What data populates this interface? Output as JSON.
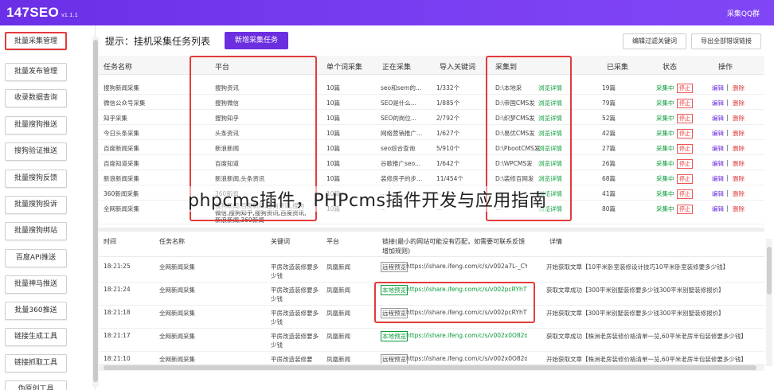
{
  "app": {
    "name": "147SEO",
    "version": "v1.1.1",
    "top_right": "采集QQ群"
  },
  "sidebar": {
    "items": [
      {
        "label": "批量采集管理",
        "active": true
      },
      {
        "label": "批量发布管理"
      },
      {
        "label": "收录数据查询"
      },
      {
        "label": "批量搜狗推送"
      },
      {
        "label": "搜狗验证推送"
      },
      {
        "label": "批量搜狗反馈"
      },
      {
        "label": "批量搜狗投诉"
      },
      {
        "label": "批量搜狗绑站"
      },
      {
        "label": "百度API推送"
      },
      {
        "label": "批量神马推送"
      },
      {
        "label": "批量360推送"
      },
      {
        "label": "链接生成工具"
      },
      {
        "label": "链接抓取工具"
      },
      {
        "label": "伪原创工具"
      }
    ]
  },
  "header": {
    "hint": "提示：挂机采集任务列表",
    "new_task": "新增采集任务",
    "filter_keywords": "编辑过滤关键词",
    "export_errors": "导出全部错误链接"
  },
  "table": {
    "columns": [
      "任务名称",
      "平台",
      "单个词采集",
      "正在采集",
      "导入关键词",
      "采集到",
      "已采集",
      "状态",
      "操作"
    ],
    "rows": [
      {
        "name": "搜狗新闻采集",
        "platform": "搜狗资讯",
        "single": "10篇",
        "current": "seo和sem的...",
        "imported": "1/332个",
        "dest": "D:\\本地采",
        "preview": "浏览详情",
        "collected": "19篇",
        "status": "采集中",
        "stop": "停止",
        "edit": "编辑",
        "delete": "删除"
      },
      {
        "name": "微信公众号采集",
        "platform": "搜狗微信",
        "single": "10篇",
        "current": "SEO是什么...",
        "imported": "1/885个",
        "dest": "D:\\帝国CMS发",
        "preview": "浏览详情",
        "collected": "79篇",
        "status": "采集中",
        "stop": "停止",
        "edit": "编辑",
        "delete": "删除"
      },
      {
        "name": "知乎采集",
        "platform": "搜狗知乎",
        "single": "10篇",
        "current": "SEO的岗位...",
        "imported": "2/792个",
        "dest": "D:\\织梦CMS发",
        "preview": "浏览详情",
        "collected": "52篇",
        "status": "采集中",
        "stop": "停止",
        "edit": "编辑",
        "delete": "删除"
      },
      {
        "name": "今日头条采集",
        "platform": "头条资讯",
        "single": "10篇",
        "current": "网络营销推广...",
        "imported": "1/627个",
        "dest": "D:\\易优CMS发",
        "preview": "浏览详情",
        "collected": "42篇",
        "status": "采集中",
        "stop": "停止",
        "edit": "编辑",
        "delete": "删除"
      },
      {
        "name": "百度新闻采集",
        "platform": "新浪新闻",
        "single": "10篇",
        "current": "seo综合查询",
        "imported": "5/910个",
        "dest": "D:\\PbootCMS发",
        "preview": "浏览详情",
        "collected": "27篇",
        "status": "采集中",
        "stop": "停止",
        "edit": "编辑",
        "delete": "删除"
      },
      {
        "name": "百度知道采集",
        "platform": "百度知道",
        "single": "10篇",
        "current": "谷歌推广seo...",
        "imported": "1/642个",
        "dest": "D:\\WPCMS发",
        "preview": "浏览详情",
        "collected": "26篇",
        "status": "采集中",
        "stop": "停止",
        "edit": "编辑",
        "delete": "删除"
      },
      {
        "name": "新浪新闻采集",
        "platform": "新浪新闻,头条资讯",
        "single": "10篇",
        "current": "装修房子的步...",
        "imported": "11/454个",
        "dest": "D:\\装修百网发",
        "preview": "浏览详情",
        "collected": "68篇",
        "status": "采集中",
        "stop": "停止",
        "edit": "编辑",
        "delete": "删除"
      },
      {
        "name": "360新闻采集",
        "platform": "360新闻",
        "single": "10篇",
        "current": "...",
        "imported": "...",
        "dest": "...",
        "preview": "浏览详情",
        "collected": "41篇",
        "status": "采集中",
        "stop": "停止",
        "edit": "编辑",
        "delete": "删除"
      },
      {
        "name": "全网新闻采集",
        "platform": "搜狗新闻,百度新闻,搜狗资讯,搜狗微信,搜狗知乎,搜狗资讯,百度资讯,新浪新闻,360新闻",
        "single": "10篇",
        "current": "...",
        "imported": "...",
        "dest": "...",
        "preview": "浏览详情",
        "collected": "80篇",
        "status": "采集中",
        "stop": "停止",
        "edit": "编辑",
        "delete": "删除"
      }
    ]
  },
  "log": {
    "columns": [
      "时间",
      "任务名称",
      "关键词",
      "平台",
      "链接(最小的网站可能没有匹配，如需要可联系反馈增加规则)",
      "详情"
    ],
    "rows": [
      {
        "time": "18:21:25",
        "task": "全网新闻采集",
        "keyword": "平房改造装修要多少钱",
        "platform": "凤凰新闻",
        "tag": "远程预览",
        "local": false,
        "url": "https://ishare.ifeng.com/c/s/v002a7L-_CYTH...",
        "detail": "开始获取文章【10平米卧室装修设计技巧10平米卧室装修要多少钱】"
      },
      {
        "time": "18:21:24",
        "task": "全网新闻采集",
        "keyword": "平房改造装修要多少钱",
        "platform": "凤凰新闻",
        "tag": "本地预览",
        "local": true,
        "url": "https://ishare.ifeng.com/c/s/v002pcRYhTWvn...",
        "detail": "获取文章成功【300平米别墅装修要多少钱300平米别墅装修报价】"
      },
      {
        "time": "18:21:18",
        "task": "全网新闻采集",
        "keyword": "平房改造装修要多少钱",
        "platform": "凤凰新闻",
        "tag": "远程预览",
        "local": false,
        "url": "https://ishare.ifeng.com/c/s/v002pcRYhTWvn...",
        "detail": "开始获取文章【300平米别墅装修要多少钱300平米别墅装修报价】"
      },
      {
        "time": "18:21:17",
        "task": "全网新闻采集",
        "keyword": "平房改造装修要多少钱",
        "platform": "凤凰新闻",
        "tag": "本地预览",
        "local": true,
        "url": "https://ishare.ifeng.com/c/s/v002x0O82dkKm...",
        "detail": "获取文章成功【株洲老房装修价格清单一览,60平米老房半包装修要多少钱】"
      },
      {
        "time": "18:21:10",
        "task": "全网新闻采集",
        "keyword": "平房改造装修要",
        "platform": "凤凰新闻",
        "tag": "远程预览",
        "local": false,
        "url": "https://ishare.ifeng.com/c/s/v002x0O82dkKm...",
        "detail": "开始获取文章【株洲老房装修价格清单一览,60平米老房半包装修要多少钱】"
      }
    ]
  },
  "watermark": "phpcms插件，PHPcms插件开发与应用指南",
  "colors": {
    "brand": "#6b2fe0",
    "highlight": "#e23b3b",
    "running": "#0a9a3a"
  }
}
